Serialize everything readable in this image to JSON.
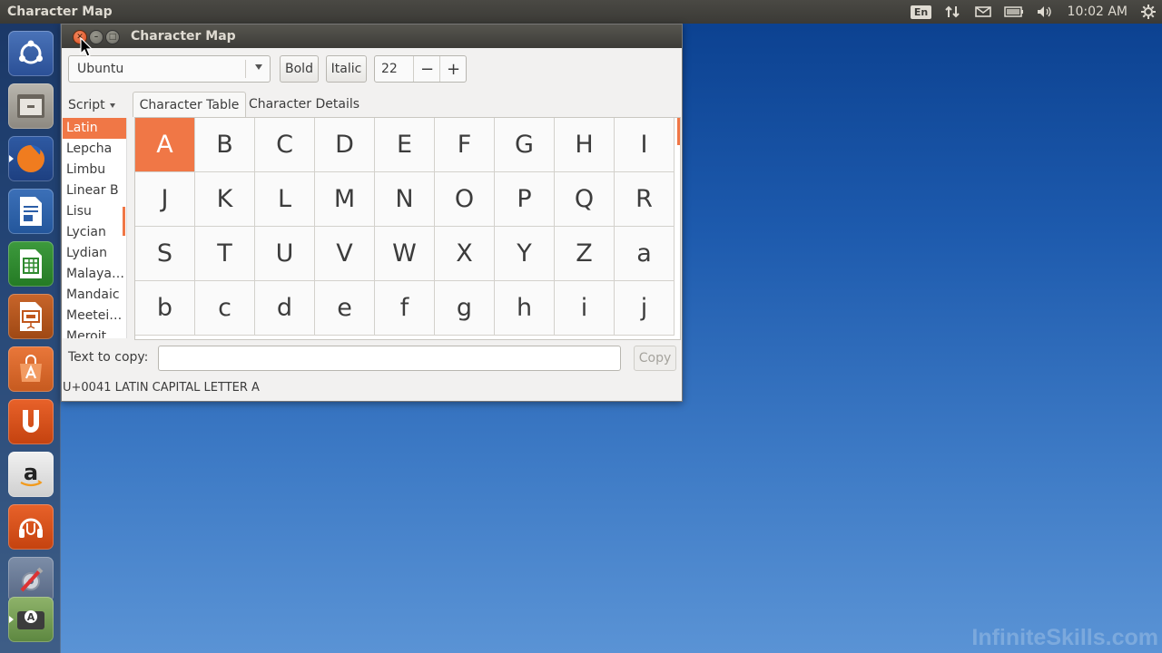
{
  "top_panel": {
    "app_title": "Character Map",
    "keyboard_layout": "En",
    "clock": "10:02 AM"
  },
  "launcher": {
    "items": [
      {
        "name": "dash-home",
        "icon": "ubuntu-logo-icon"
      },
      {
        "name": "files",
        "icon": "file-cabinet-icon"
      },
      {
        "name": "firefox",
        "icon": "firefox-icon"
      },
      {
        "name": "libreoffice-writer",
        "icon": "writer-document-icon"
      },
      {
        "name": "libreoffice-calc",
        "icon": "calc-spreadsheet-icon"
      },
      {
        "name": "libreoffice-impress",
        "icon": "impress-presentation-icon"
      },
      {
        "name": "software-center",
        "icon": "shopping-bag-icon"
      },
      {
        "name": "ubuntu-one",
        "icon": "ubuntu-one-icon"
      },
      {
        "name": "amazon",
        "icon": "amazon-icon"
      },
      {
        "name": "ubuntu-one-music",
        "icon": "headphones-icon"
      },
      {
        "name": "system-settings",
        "icon": "settings-tools-icon"
      },
      {
        "name": "character-map",
        "icon": "character-map-icon"
      }
    ]
  },
  "window": {
    "title": "Character Map",
    "toolbar": {
      "font_value": "Ubuntu",
      "bold_label": "Bold",
      "italic_label": "Italic",
      "size_value": "22",
      "minus_label": "−",
      "plus_label": "+"
    },
    "script": {
      "header_label": "Script",
      "items": [
        "Latin",
        "Lepcha",
        "Limbu",
        "Linear B",
        "Lisu",
        "Lycian",
        "Lydian",
        "Malaya…",
        "Mandaic",
        "Meetei…",
        "Meroit…"
      ],
      "selected": "Latin"
    },
    "tabs": [
      "Character Table",
      "Character Details"
    ],
    "characters": [
      "A",
      "B",
      "C",
      "D",
      "E",
      "F",
      "G",
      "H",
      "I",
      "J",
      "K",
      "L",
      "M",
      "N",
      "O",
      "P",
      "Q",
      "R",
      "S",
      "T",
      "U",
      "V",
      "W",
      "X",
      "Y",
      "Z",
      "a",
      "b",
      "c",
      "d",
      "e",
      "f",
      "g",
      "h",
      "i",
      "j"
    ],
    "selected_character": "A",
    "copy": {
      "label": "Text to copy:",
      "value": "",
      "button_label": "Copy"
    },
    "status": "U+0041 LATIN CAPITAL LETTER A"
  },
  "watermark": "InfiniteSkills.com",
  "colors": {
    "accent": "#f07746",
    "panel": "#3b3a36"
  }
}
